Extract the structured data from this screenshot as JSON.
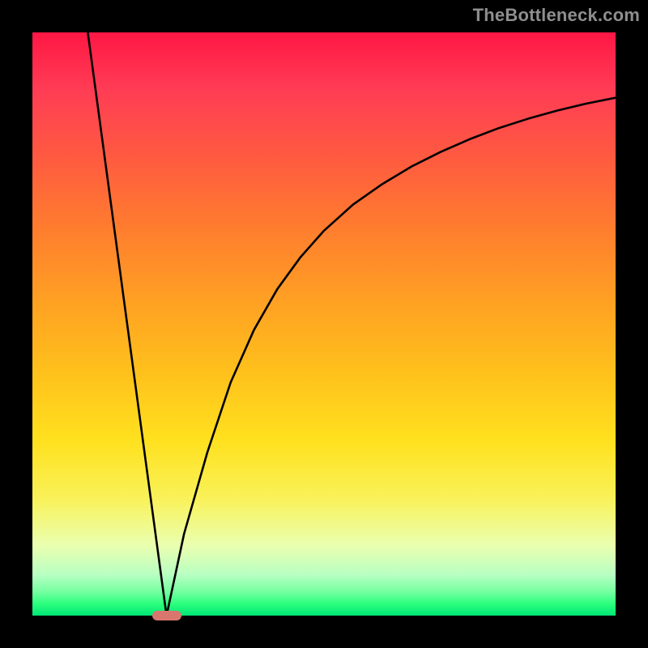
{
  "watermark": "TheBottleneck.com",
  "chart_data": {
    "type": "line",
    "title": "",
    "xlabel": "",
    "ylabel": "",
    "xlim": [
      0,
      100
    ],
    "ylim": [
      0,
      100
    ],
    "grid": false,
    "series": [
      {
        "name": "left-slope",
        "x": [
          9.5,
          23.0
        ],
        "y": [
          100,
          0
        ]
      },
      {
        "name": "right-curve",
        "x": [
          23,
          26,
          30,
          34,
          38,
          42,
          46,
          50,
          55,
          60,
          65,
          70,
          75,
          80,
          85,
          90,
          95,
          100
        ],
        "y": [
          0,
          14,
          28,
          40,
          49,
          56,
          61.5,
          66,
          70.5,
          74,
          77,
          79.5,
          81.7,
          83.6,
          85.2,
          86.6,
          87.8,
          88.8
        ]
      }
    ],
    "annotations": [
      {
        "name": "minimum-marker",
        "shape": "rounded-bar",
        "color": "#d9776f",
        "x_center": 23,
        "y": 0,
        "width_pct": 5.0,
        "height_pct": 1.6
      }
    ],
    "background": {
      "type": "vertical-gradient",
      "stops": [
        {
          "pos": 0,
          "color": "#ff1744"
        },
        {
          "pos": 50,
          "color": "#ffb300"
        },
        {
          "pos": 80,
          "color": "#f9f25a"
        },
        {
          "pos": 100,
          "color": "#00e676"
        }
      ]
    }
  }
}
